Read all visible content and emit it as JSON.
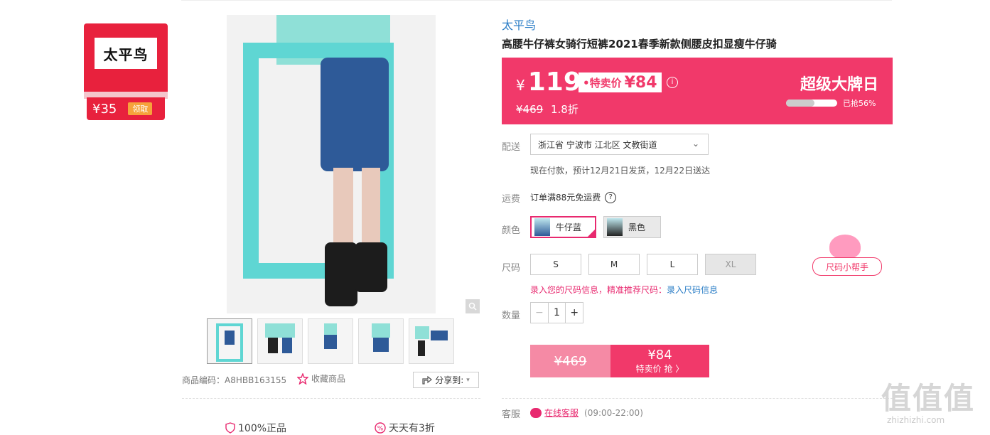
{
  "coupon": {
    "brand_logo": "太平鸟",
    "amount": "¥35",
    "action": "领取"
  },
  "gallery": {
    "zoom_icon": "magnifier-icon",
    "thumbnail_count": 5
  },
  "product": {
    "brand": "太平鸟",
    "title": "高腰牛仔裤女骑行短裤2021春季新款侧腰皮扣显瘦牛仔骑"
  },
  "price": {
    "currency": "¥",
    "current": "119",
    "special_label": "•特卖价",
    "special_price": "¥84",
    "original": "¥469",
    "discount": "1.8折",
    "deal_name": "超级大牌日",
    "sold_text": "已抢56%",
    "sold_fraction": 0.56,
    "brand_color": "#f1396a"
  },
  "shipping": {
    "label": "配送",
    "address": "浙江省 宁波市 江北区 文教街道",
    "eta": "现在付款，预计12月21日发货，12月22日送达"
  },
  "fee": {
    "label": "运费",
    "text": "订单满88元免运费"
  },
  "color": {
    "label": "颜色",
    "options": [
      {
        "name": "牛仔蓝",
        "selected": true
      },
      {
        "name": "黑色",
        "selected": false
      }
    ]
  },
  "size": {
    "label": "尺码",
    "options": [
      "S",
      "M",
      "L",
      "XL"
    ],
    "disabled": [
      "XL"
    ],
    "hint": "录入您的尺码信息，精准推荐尺码：",
    "hint_link": "录入尺码信息",
    "helper": "尺码小帮手"
  },
  "quantity": {
    "label": "数量",
    "value": "1",
    "minus": "−",
    "plus": "+"
  },
  "buy": {
    "original_price": "¥469",
    "special_price": "¥84",
    "special_text": "特卖价 抢 〉"
  },
  "meta": {
    "sku_code": "商品编码：A8HBB163155",
    "favorite": "收藏商品",
    "share": "分享到:",
    "guarantee_1": "100%正品",
    "guarantee_2": "天天有3折"
  },
  "service": {
    "label": "客服",
    "link": "在线客服",
    "hours": "(09:00-22:00)"
  },
  "watermark": {
    "logo": "值值值",
    "site": "zhizhizhi.com"
  }
}
